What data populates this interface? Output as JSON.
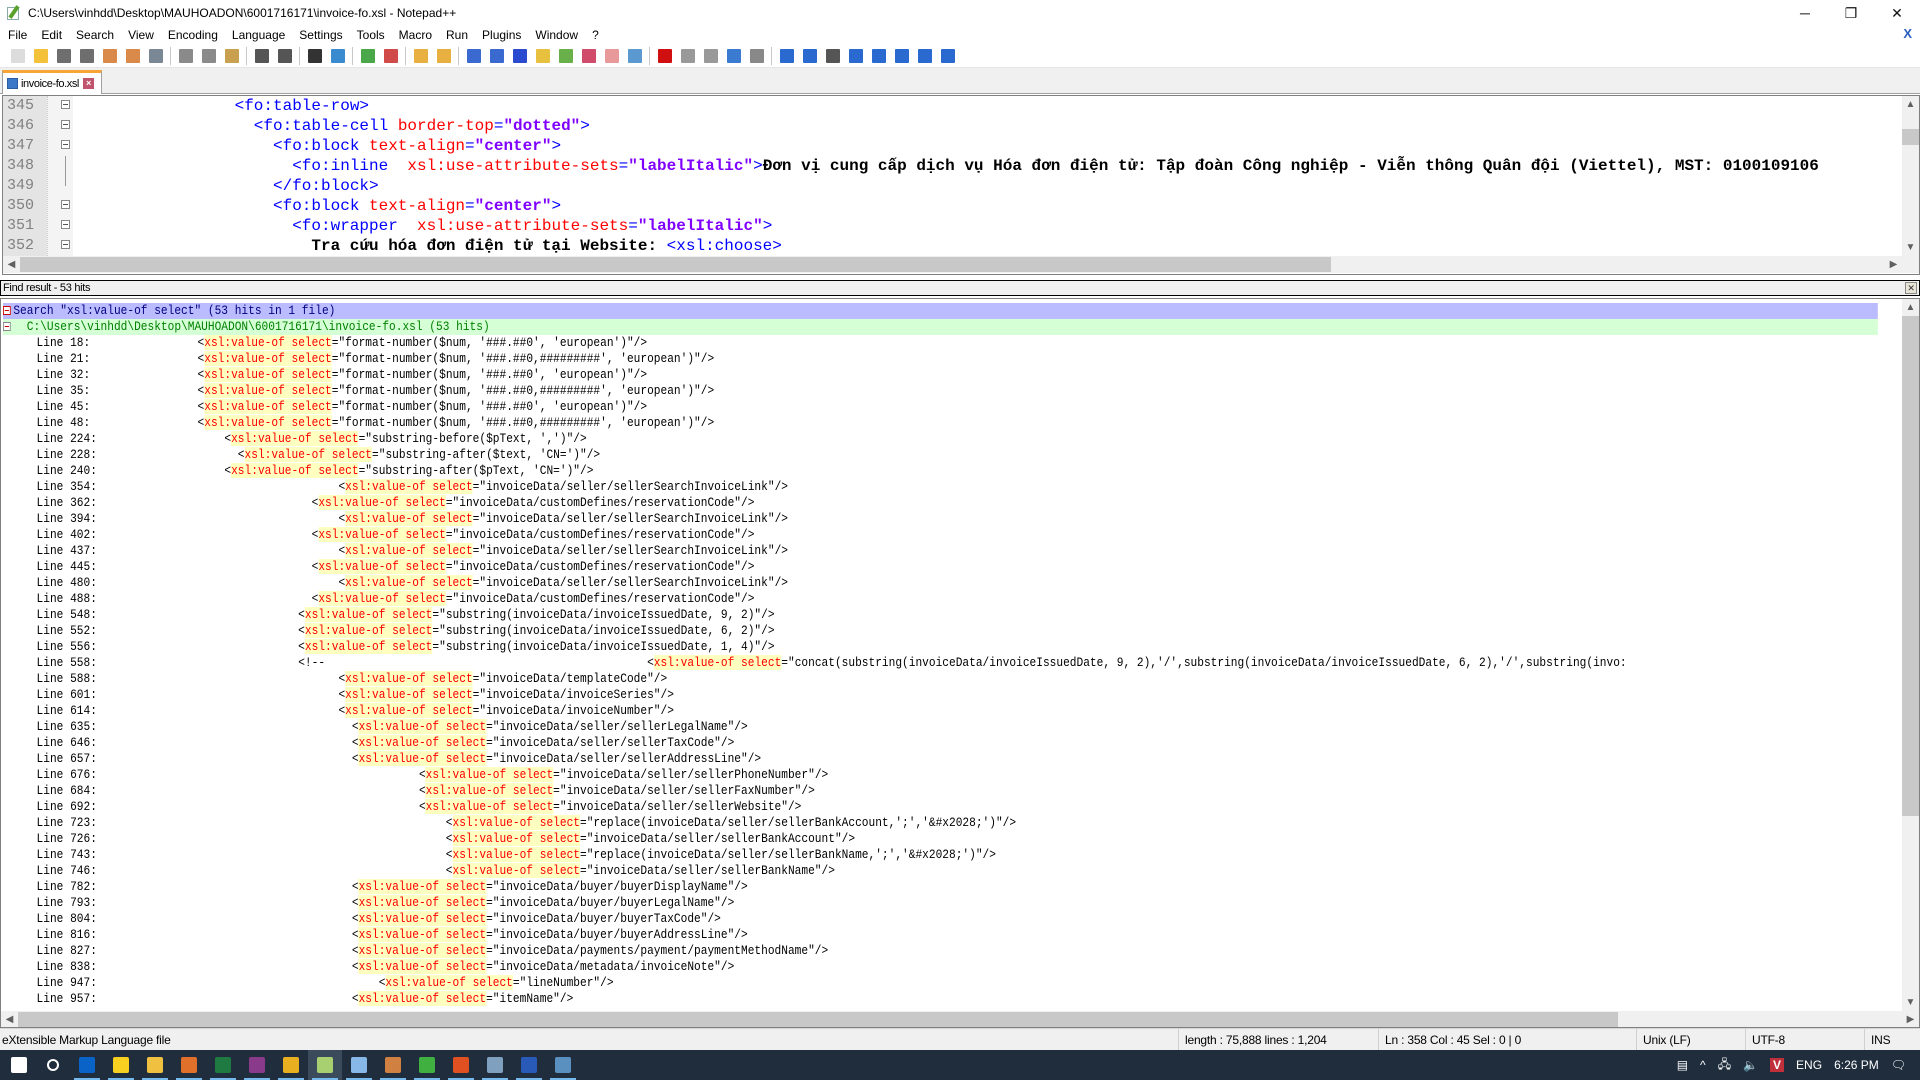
{
  "window": {
    "title": "C:\\Users\\vinhdd\\Desktop\\MAUHOADON\\6001716171\\invoice-fo.xsl - Notepad++",
    "controls": {
      "minimize": "─",
      "maximize": "❐",
      "close": "✕"
    }
  },
  "menu": {
    "items": [
      "File",
      "Edit",
      "Search",
      "View",
      "Encoding",
      "Language",
      "Settings",
      "Tools",
      "Macro",
      "Run",
      "Plugins",
      "Window",
      "?"
    ],
    "close_doc": "X"
  },
  "toolbar": {
    "groups": [
      [
        {
          "icon": "new-file-icon",
          "color": "#dcdcdc"
        },
        {
          "icon": "open-file-icon",
          "color": "#f3c23a"
        },
        {
          "icon": "save-icon",
          "color": "#6e6e6e"
        },
        {
          "icon": "save-all-icon",
          "color": "#6e6e6e"
        },
        {
          "icon": "close-icon",
          "color": "#d98a4a"
        },
        {
          "icon": "close-all-icon",
          "color": "#d98a4a"
        },
        {
          "icon": "print-icon",
          "color": "#7a8896"
        }
      ],
      [
        {
          "icon": "cut-icon",
          "color": "#8a8a8a"
        },
        {
          "icon": "copy-icon",
          "color": "#8a8a8a"
        },
        {
          "icon": "paste-icon",
          "color": "#c8a050"
        }
      ],
      [
        {
          "icon": "undo-icon",
          "color": "#555555"
        },
        {
          "icon": "redo-icon",
          "color": "#555555"
        }
      ],
      [
        {
          "icon": "find-icon",
          "color": "#333333"
        },
        {
          "icon": "replace-icon",
          "color": "#3a8ad0"
        }
      ],
      [
        {
          "icon": "zoom-in-icon",
          "color": "#4aa84a"
        },
        {
          "icon": "zoom-out-icon",
          "color": "#d04a4a"
        }
      ],
      [
        {
          "icon": "sync-vertical-icon",
          "color": "#e8b040"
        },
        {
          "icon": "sync-horizontal-icon",
          "color": "#e8b040"
        }
      ],
      [
        {
          "icon": "word-wrap-icon",
          "color": "#3a6ad0"
        },
        {
          "icon": "show-all-chars-icon",
          "color": "#3a6ad0"
        },
        {
          "icon": "indent-guide-icon",
          "color": "#2a4ad0"
        },
        {
          "icon": "user-lang-icon",
          "color": "#e8c040"
        },
        {
          "icon": "doc-map-icon",
          "color": "#6ab04a"
        },
        {
          "icon": "function-list-icon",
          "color": "#d04a6a"
        },
        {
          "icon": "folder-workspace-icon",
          "color": "#e89a9a"
        },
        {
          "icon": "monitoring-icon",
          "color": "#5a9ad0"
        }
      ],
      [
        {
          "icon": "record-macro-icon",
          "color": "#d01010"
        },
        {
          "icon": "stop-macro-icon",
          "color": "#999999"
        },
        {
          "icon": "play-macro-icon",
          "color": "#999999"
        },
        {
          "icon": "run-macro-multiple-icon",
          "color": "#3a7ad0"
        },
        {
          "icon": "save-macro-icon",
          "color": "#888888"
        }
      ],
      [
        {
          "icon": "compare-icon",
          "color": "#2a6ad0"
        },
        {
          "icon": "compare-panel-icon",
          "color": "#2a6ad0"
        },
        {
          "icon": "clear-compare-icon",
          "color": "#555555"
        },
        {
          "icon": "first-diff-icon",
          "color": "#2a6ad0"
        },
        {
          "icon": "prev-diff-icon",
          "color": "#2a6ad0"
        },
        {
          "icon": "next-diff-icon",
          "color": "#2a6ad0"
        },
        {
          "icon": "last-diff-icon",
          "color": "#2a6ad0"
        },
        {
          "icon": "diff-bar-icon",
          "color": "#2a6ad0"
        }
      ]
    ]
  },
  "tabs": [
    {
      "label": "invoice-fo.xsl",
      "active": true
    }
  ],
  "editor": {
    "lines": [
      {
        "num": "345",
        "fold": "box",
        "indent": 16,
        "parts": [
          [
            "tag",
            "<fo:table-row>"
          ]
        ]
      },
      {
        "num": "346",
        "fold": "box",
        "indent": 18,
        "parts": [
          [
            "tag",
            "<fo:table-cell "
          ],
          [
            "attr",
            "border-top"
          ],
          [
            "tag",
            "="
          ],
          [
            "val",
            "\"dotted\""
          ],
          [
            "tag",
            ">"
          ]
        ]
      },
      {
        "num": "347",
        "fold": "box",
        "indent": 20,
        "parts": [
          [
            "tag",
            "<fo:block "
          ],
          [
            "attr",
            "text-align"
          ],
          [
            "tag",
            "="
          ],
          [
            "val",
            "\"center\""
          ],
          [
            "tag",
            ">"
          ]
        ]
      },
      {
        "num": "348",
        "fold": "line",
        "indent": 22,
        "parts": [
          [
            "tag",
            "<fo:inline  "
          ],
          [
            "attr",
            "xsl:use-attribute-sets"
          ],
          [
            "tag",
            "="
          ],
          [
            "val",
            "\"labelItalic\""
          ],
          [
            "tag",
            ">"
          ],
          [
            "txt",
            "Đơn vị cung cấp dịch vụ Hóa đơn điện tử: Tập đoàn Công nghiệp - Viễn thông Quân đội (Viettel), MST: 0100109106"
          ]
        ]
      },
      {
        "num": "349",
        "fold": "end",
        "indent": 20,
        "parts": [
          [
            "tag",
            "</fo:block>"
          ]
        ]
      },
      {
        "num": "350",
        "fold": "box",
        "indent": 20,
        "parts": [
          [
            "tag",
            "<fo:block "
          ],
          [
            "attr",
            "text-align"
          ],
          [
            "tag",
            "="
          ],
          [
            "val",
            "\"center\""
          ],
          [
            "tag",
            ">"
          ]
        ]
      },
      {
        "num": "351",
        "fold": "box",
        "indent": 22,
        "parts": [
          [
            "tag",
            "<fo:wrapper  "
          ],
          [
            "attr",
            "xsl:use-attribute-sets"
          ],
          [
            "tag",
            "="
          ],
          [
            "val",
            "\"labelItalic\""
          ],
          [
            "tag",
            ">"
          ]
        ]
      },
      {
        "num": "352",
        "fold": "box",
        "indent": 24,
        "parts": [
          [
            "txt",
            "Tra cứu hóa đơn điện tử tại Website: "
          ],
          [
            "tag",
            "<xsl:choose>"
          ]
        ]
      }
    ]
  },
  "find_panel": {
    "title": "Find result - 53 hits",
    "close": "✕",
    "search_header": "Search \"xsl:value-of select\" (53 hits in 1 file)",
    "file_header": "C:\\Users\\vinhdd\\Desktop\\MAUHOADON\\6001716171\\invoice-fo.xsl (53 hits)",
    "hits": [
      {
        "line": "Line 18:",
        "indent": 11,
        "rest": "=\"format-number($num, '###.##0', 'european')\"/>"
      },
      {
        "line": "Line 21:",
        "indent": 11,
        "rest": "=\"format-number($num, '###.##0,#########', 'european')\"/>"
      },
      {
        "line": "Line 32:",
        "indent": 11,
        "rest": "=\"format-number($num, '###.##0', 'european')\"/>"
      },
      {
        "line": "Line 35:",
        "indent": 11,
        "rest": "=\"format-number($num, '###.##0,#########', 'european')\"/>"
      },
      {
        "line": "Line 45:",
        "indent": 11,
        "rest": "=\"format-number($num, '###.##0', 'european')\"/>"
      },
      {
        "line": "Line 48:",
        "indent": 11,
        "rest": "=\"format-number($num, '###.##0,#########', 'european')\"/>"
      },
      {
        "line": "Line 224:",
        "indent": 15,
        "rest": "=\"substring-before($pText, ',')\"/>"
      },
      {
        "line": "Line 228:",
        "indent": 17,
        "rest": "=\"substring-after($text, 'CN=')\"/>"
      },
      {
        "line": "Line 240:",
        "indent": 15,
        "rest": "=\"substring-after($pText, 'CN=')\"/>"
      },
      {
        "line": "Line 354:",
        "indent": 32,
        "rest": "=\"invoiceData/seller/sellerSearchInvoiceLink\"/>"
      },
      {
        "line": "Line 362:",
        "indent": 28,
        "rest": "=\"invoiceData/customDefines/reservationCode\"/>"
      },
      {
        "line": "Line 394:",
        "indent": 32,
        "rest": "=\"invoiceData/seller/sellerSearchInvoiceLink\"/>"
      },
      {
        "line": "Line 402:",
        "indent": 28,
        "rest": "=\"invoiceData/customDefines/reservationCode\"/>"
      },
      {
        "line": "Line 437:",
        "indent": 32,
        "rest": "=\"invoiceData/seller/sellerSearchInvoiceLink\"/>"
      },
      {
        "line": "Line 445:",
        "indent": 28,
        "rest": "=\"invoiceData/customDefines/reservationCode\"/>"
      },
      {
        "line": "Line 480:",
        "indent": 32,
        "rest": "=\"invoiceData/seller/sellerSearchInvoiceLink\"/>"
      },
      {
        "line": "Line 488:",
        "indent": 28,
        "rest": "=\"invoiceData/customDefines/reservationCode\"/>"
      },
      {
        "line": "Line 548:",
        "indent": 26,
        "rest": "=\"substring(invoiceData/invoiceIssuedDate, 9, 2)\"/>"
      },
      {
        "line": "Line 552:",
        "indent": 26,
        "rest": "=\"substring(invoiceData/invoiceIssuedDate, 6, 2)\"/>"
      },
      {
        "line": "Line 556:",
        "indent": 26,
        "rest": "=\"substring(invoiceData/invoiceIssuedDate, 1, 4)\"/>"
      },
      {
        "line": "Line 558:",
        "indent": 26,
        "prefix": "<!--",
        "prefix_gap": 48,
        "rest": "=\"concat(substring(invoiceData/invoiceIssuedDate, 9, 2),'/',substring(invoiceData/invoiceIssuedDate, 6, 2),'/',substring(invo:"
      },
      {
        "line": "Line 588:",
        "indent": 32,
        "rest": "=\"invoiceData/templateCode\"/>"
      },
      {
        "line": "Line 601:",
        "indent": 32,
        "rest": "=\"invoiceData/invoiceSeries\"/>"
      },
      {
        "line": "Line 614:",
        "indent": 32,
        "rest": "=\"invoiceData/invoiceNumber\"/>"
      },
      {
        "line": "Line 635:",
        "indent": 34,
        "rest": "=\"invoiceData/seller/sellerLegalName\"/>"
      },
      {
        "line": "Line 646:",
        "indent": 34,
        "rest": "=\"invoiceData/seller/sellerTaxCode\"/>"
      },
      {
        "line": "Line 657:",
        "indent": 34,
        "rest": "=\"invoiceData/seller/sellerAddressLine\"/>"
      },
      {
        "line": "Line 676:",
        "indent": 44,
        "rest": "=\"invoiceData/seller/sellerPhoneNumber\"/>"
      },
      {
        "line": "Line 684:",
        "indent": 44,
        "rest": "=\"invoiceData/seller/sellerFaxNumber\"/>"
      },
      {
        "line": "Line 692:",
        "indent": 44,
        "rest": "=\"invoiceData/seller/sellerWebsite\"/>"
      },
      {
        "line": "Line 723:",
        "indent": 48,
        "rest": "=\"replace(invoiceData/seller/sellerBankAccount,';','&#x2028;')\"/>"
      },
      {
        "line": "Line 726:",
        "indent": 48,
        "rest": "=\"invoiceData/seller/sellerBankAccount\"/>"
      },
      {
        "line": "Line 743:",
        "indent": 48,
        "rest": "=\"replace(invoiceData/seller/sellerBankName,';','&#x2028;')\"/>"
      },
      {
        "line": "Line 746:",
        "indent": 48,
        "rest": "=\"invoiceData/seller/sellerBankName\"/>"
      },
      {
        "line": "Line 782:",
        "indent": 34,
        "rest": "=\"invoiceData/buyer/buyerDisplayName\"/>"
      },
      {
        "line": "Line 793:",
        "indent": 34,
        "rest": "=\"invoiceData/buyer/buyerLegalName\"/>"
      },
      {
        "line": "Line 804:",
        "indent": 34,
        "rest": "=\"invoiceData/buyer/buyerTaxCode\"/>"
      },
      {
        "line": "Line 816:",
        "indent": 34,
        "rest": "=\"invoiceData/buyer/buyerAddressLine\"/>"
      },
      {
        "line": "Line 827:",
        "indent": 34,
        "rest": "=\"invoiceData/payments/payment/paymentMethodName\"/>"
      },
      {
        "line": "Line 838:",
        "indent": 34,
        "rest": "=\"invoiceData/metadata/invoiceNote\"/>"
      },
      {
        "line": "Line 947:",
        "indent": 38,
        "rest": "=\"lineNumber\"/>"
      },
      {
        "line": "Line 957:",
        "indent": 34,
        "rest": "=\"itemName\"/>"
      }
    ],
    "match_kw1": "xsl:value-of",
    "match_kw2": "select"
  },
  "status": {
    "file_type": "eXtensible Markup Language file",
    "length": "length : 75,888    lines : 1,204",
    "position": "Ln : 358    Col : 45    Sel : 0 | 0",
    "eol": "Unix (LF)",
    "encoding": "UTF-8",
    "mode": "INS"
  },
  "taskbar": {
    "apps": [
      {
        "name": "start-button",
        "color": "#ffffff"
      },
      {
        "name": "search-button",
        "color": "#ffffff"
      },
      {
        "name": "outlook-app",
        "color": "#0a64c8",
        "run": true
      },
      {
        "name": "sticky-notes-app",
        "color": "#f8d020",
        "run": true
      },
      {
        "name": "file-explorer-app",
        "color": "#f0c040",
        "run": true
      },
      {
        "name": "sublime-app",
        "color": "#e0702a",
        "run": true
      },
      {
        "name": "excel-app",
        "color": "#1e7a40",
        "run": true
      },
      {
        "name": "winrar-app",
        "color": "#8a3a8a",
        "run": true
      },
      {
        "name": "chrome-app",
        "color": "#e8b020",
        "run": true
      },
      {
        "name": "notepadpp-app",
        "color": "#a8d070",
        "run": true,
        "active": true
      },
      {
        "name": "notepad-app",
        "color": "#88b8e8",
        "run": true
      },
      {
        "name": "paint-app",
        "color": "#d08040",
        "run": true
      },
      {
        "name": "teamviewer-app",
        "color": "#40b040",
        "run": true
      },
      {
        "name": "anydesk-app",
        "color": "#e05020",
        "run": true
      },
      {
        "name": "task-manager-app",
        "color": "#80a0c0",
        "run": true
      },
      {
        "name": "word-app",
        "color": "#2a5ab8",
        "run": true
      },
      {
        "name": "remote-desktop-app",
        "color": "#5a90c0",
        "run": true
      }
    ],
    "tray": {
      "news": "▤",
      "chevron": "^",
      "network": "🖧",
      "volume": "🔈",
      "vpn": "V",
      "language": "ENG",
      "time": "6:26 PM",
      "notifications": "🗨"
    }
  }
}
